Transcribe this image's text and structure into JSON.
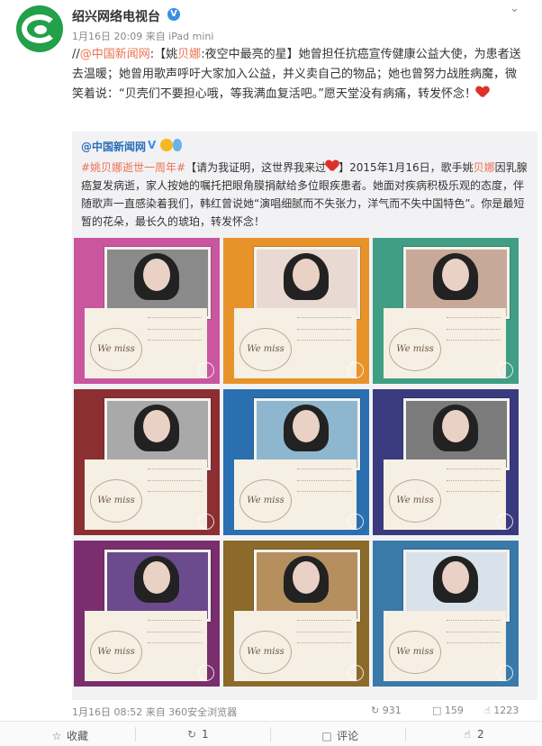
{
  "account": {
    "name": "绍兴网络电视台",
    "verified_mark": "V",
    "meta": "1月16日 20:09 来自 iPad mini"
  },
  "post": {
    "prefix": "//",
    "mention": "@中国新闻网",
    "body_a": ":【姚",
    "highlight": "贝娜",
    "body_b": ":夜空中最亮的星】她曾担任抗癌宣传健康公益大使，为患者送去温暖；她曾用歌声呼吁大家加入公益，并义卖自己的物品；她也曾努力战胜病魔，微笑着说：“贝壳们不要担心哦，等我满血复活吧。”愿天堂没有病痛，转发怀念！"
  },
  "repost": {
    "author": "@中国新闻网",
    "verified_mark": "V",
    "hashtag": "#姚贝娜逝世一周年#",
    "quote": "【请为我证明，这世界我来过",
    "body_a": "】2015年1月16日，歌手姚",
    "highlight": "贝娜",
    "body_b": "因乳腺癌复发病逝，家人按她的嘱托把眼角膜捐献给多位眼疾患者。她面对疾病积极乐观的态度，伴随歌声一直感染着我们，韩红曾说她“演唱细腻而不失张力，洋气而不失中国特色”。你是最短暂的花朵，最长久的琥珀，转发怀念！",
    "tiles": [
      {
        "bg": "#c9569e",
        "photo_bg": "#8a8a8a",
        "caption": "We miss you."
      },
      {
        "bg": "#e7932a",
        "photo_bg": "#e9d9d3",
        "caption": "We miss you."
      },
      {
        "bg": "#3f9e84",
        "photo_bg": "#c8a999",
        "caption": "We miss you."
      },
      {
        "bg": "#8c2f32",
        "photo_bg": "#a9a9a9",
        "caption": "We miss you."
      },
      {
        "bg": "#2a6fb0",
        "photo_bg": "#8fb6cf",
        "caption": "We miss you."
      },
      {
        "bg": "#3a3a7e",
        "photo_bg": "#7b7b7b",
        "caption": "We miss you."
      },
      {
        "bg": "#7a2e6e",
        "photo_bg": "#6b4a8e",
        "caption": "We miss you."
      },
      {
        "bg": "#8c6a2a",
        "photo_bg": "#b58f5e",
        "caption": "We miss you."
      },
      {
        "bg": "#3a7aa8",
        "photo_bg": "#d9e2ea",
        "caption": "We miss you."
      }
    ],
    "time": "1月16日 08:52 来自 360安全浏览器",
    "reposts": "931",
    "comments": "159",
    "likes": "1223"
  },
  "actions": {
    "favorite": "收藏",
    "repost": "1",
    "comment": "评论",
    "like": "2"
  },
  "icons": {
    "caret": "chevron-down-icon",
    "repost": "repost-icon",
    "comment": "comment-icon",
    "like": "thumbs-up-icon",
    "favorite": "star-icon"
  }
}
